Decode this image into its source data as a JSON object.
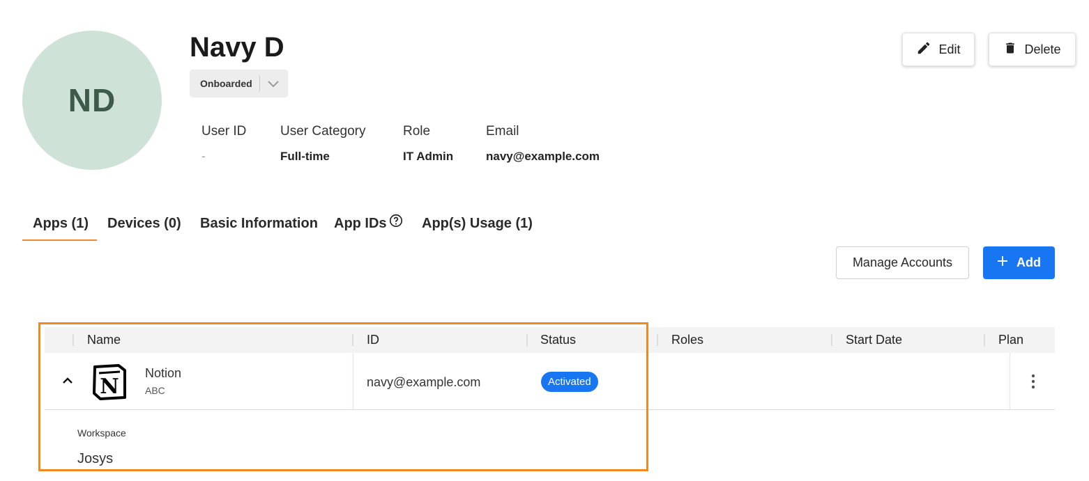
{
  "profile": {
    "initials": "ND",
    "name": "Navy D",
    "status": "Onboarded",
    "fields": [
      {
        "label": "User ID",
        "value": "-"
      },
      {
        "label": "User Category",
        "value": "Full-time"
      },
      {
        "label": "Role",
        "value": "IT Admin"
      },
      {
        "label": "Email",
        "value": "navy@example.com"
      }
    ]
  },
  "actions": {
    "edit": "Edit",
    "delete": "Delete"
  },
  "tabs": [
    {
      "label": "Apps (1)",
      "active": true
    },
    {
      "label": "Devices (0)"
    },
    {
      "label": "Basic Information"
    },
    {
      "label": "App IDs"
    },
    {
      "label": "App(s) Usage (1)"
    }
  ],
  "toolbar": {
    "manage_accounts": "Manage Accounts",
    "add": "Add"
  },
  "table": {
    "columns": [
      "Name",
      "ID",
      "Status",
      "Roles",
      "Start Date",
      "Plan"
    ],
    "rows": [
      {
        "app_name": "Notion",
        "app_sub": "ABC",
        "id": "navy@example.com",
        "status": "Activated",
        "roles": "",
        "start_date": "",
        "plan": "",
        "expanded": true,
        "details": {
          "label": "Workspace",
          "value": "Josys"
        }
      }
    ]
  },
  "colors": {
    "accent_orange": "#f0892d",
    "primary_blue": "#1976f2",
    "avatar_bg": "#cfe2d7",
    "avatar_text": "#3d5a4a"
  },
  "icons": [
    "pencil-icon",
    "trash-icon",
    "chevron-down-icon",
    "help-circle-icon",
    "plus-icon",
    "chevron-up-icon",
    "notion-logo",
    "kebab-menu-icon"
  ]
}
